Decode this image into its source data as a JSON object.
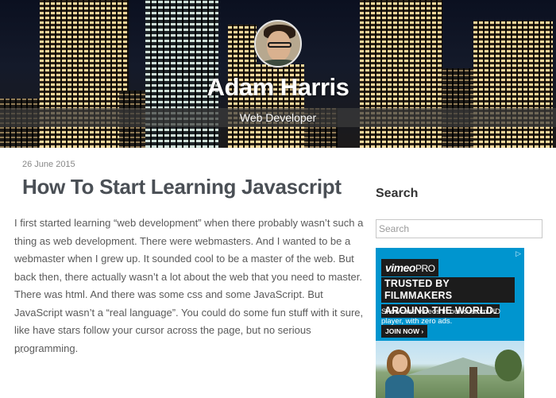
{
  "header": {
    "site_title": "Adam Harris",
    "tagline": "Web Developer"
  },
  "post": {
    "date": "26 June 2015",
    "title": "How To Start Learning Javascript",
    "body": "I first started learning “web development” when there probably wasn’t such a thing as web development. There were webmasters. And I wanted to be a webmaster when I grew up. It sounded cool to be a master of the web. But back then, there actually wasn’t a lot about the web that you need to master. There was html. And there was some css and some JavaScript. But JavaScript wasn’t a “real language”. You could do some fun stuff with it sure, like have stars follow your cursor across the page, but no serious programming.",
    "more": "…"
  },
  "sidebar": {
    "search_title": "Search",
    "search_placeholder": "Search"
  },
  "ad": {
    "adchoices": "▷",
    "logo_main": "vimeo",
    "logo_pro": "PRO",
    "headline_lines": [
      "TRUSTED BY FILMMAKERS",
      "AROUND THE WORLD."
    ],
    "sub": "Showcase videos in our custom HD player, with zero ads.",
    "cta": "JOIN NOW ›"
  },
  "colors": {
    "accent": "#0095cf",
    "title_gray": "#4a4f55",
    "header_bar": "#3c3c3c"
  }
}
